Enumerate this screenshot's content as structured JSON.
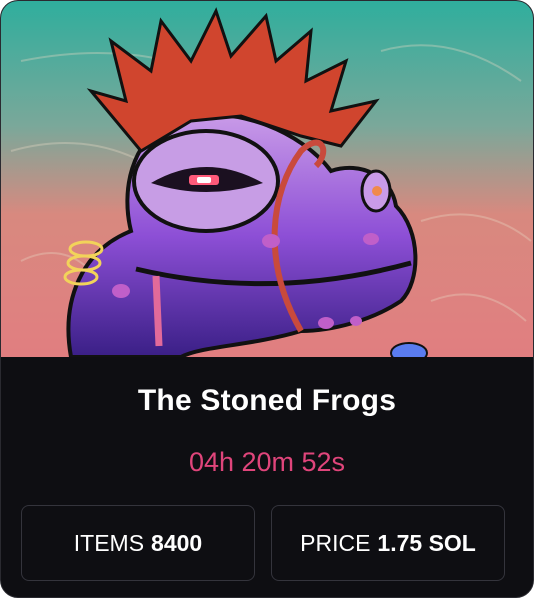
{
  "collection": {
    "title": "The Stoned Frogs",
    "countdown": "04h 20m 52s",
    "items_label": "ITEMS",
    "items_value": "8400",
    "price_label": "PRICE",
    "price_value": "1.75 SOL"
  },
  "colors": {
    "card_background": "#0e0e12",
    "countdown": "#e0457b",
    "stat_border": "#34343c"
  }
}
